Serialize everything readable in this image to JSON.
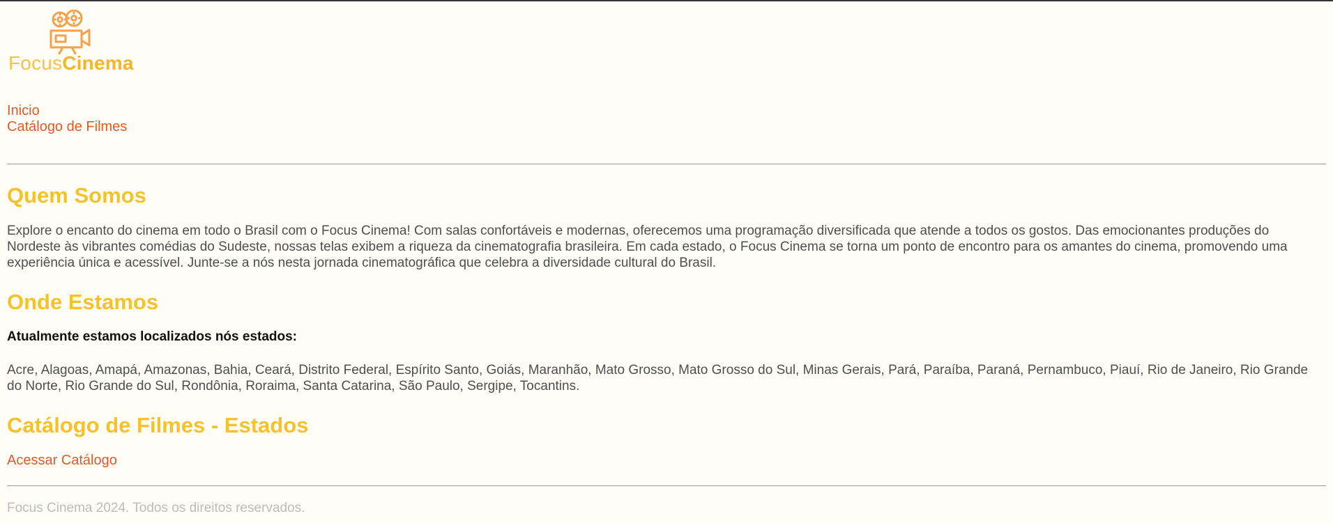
{
  "brand": {
    "logo_icon": "film-camera-icon",
    "wordmark_light": "Focus",
    "wordmark_bold": "Cinema",
    "colors": {
      "primary_orange": "#e05a2b",
      "accent_yellow": "#f6c22b",
      "logo_orange": "#f5a04a"
    }
  },
  "nav": {
    "items": [
      {
        "label": "Inicio"
      },
      {
        "label": "Catálogo de Filmes"
      }
    ]
  },
  "about": {
    "heading": "Quem Somos",
    "text": "Explore o encanto do cinema em todo o Brasil com o Focus Cinema! Com salas confortáveis e modernas, oferecemos uma programação diversificada que atende a todos os gostos. Das emocionantes produções do Nordeste às vibrantes comédias do Sudeste, nossas telas exibem a riqueza da cinematografia brasileira. Em cada estado, o Focus Cinema se torna um ponto de encontro para os amantes do cinema, promovendo uma experiência única e acessível. Junte-se a nós nesta jornada cinematográfica que celebra a diversidade cultural do Brasil."
  },
  "locations": {
    "heading": "Onde Estamos",
    "intro": "Atualmente estamos localizados nós estados:",
    "states": "Acre, Alagoas, Amapá, Amazonas, Bahia, Ceará, Distrito Federal, Espírito Santo, Goiás, Maranhão, Mato Grosso, Mato Grosso do Sul, Minas Gerais, Pará, Paraíba, Paraná, Pernambuco, Piauí, Rio de Janeiro, Rio Grande do Norte, Rio Grande do Sul, Rondônia, Roraima, Santa Catarina, São Paulo, Sergipe, Tocantins."
  },
  "catalog": {
    "heading": "Catálogo de Filmes - Estados",
    "link": "Acessar Catálogo"
  },
  "footer": {
    "text": "Focus Cinema 2024. Todos os direitos reservados."
  }
}
